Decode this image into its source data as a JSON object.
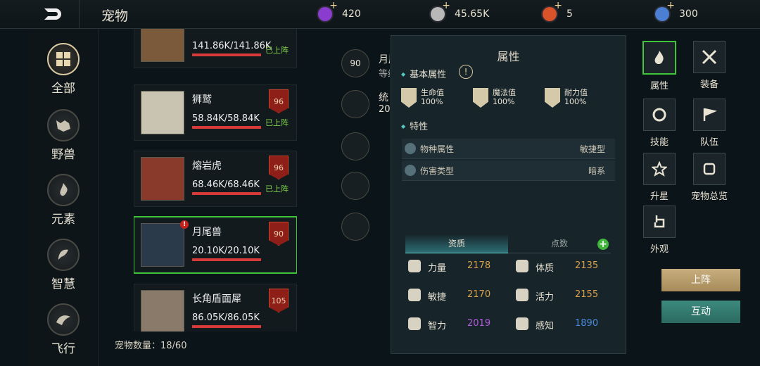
{
  "header": {
    "title": "宠物",
    "resources": [
      {
        "icon": "purple-gem-icon",
        "value": "420",
        "color": "#8a3ccf"
      },
      {
        "icon": "silver-coin-icon",
        "value": "45.65K",
        "color": "#b8b8b8"
      },
      {
        "icon": "fire-orb-icon",
        "value": "5",
        "color": "#d8522a"
      },
      {
        "icon": "blue-crystal-icon",
        "value": "300",
        "color": "#4a7fd4"
      }
    ]
  },
  "leftnav": {
    "items": [
      {
        "label": "全部",
        "icon": "grid-icon"
      },
      {
        "label": "野兽",
        "icon": "beast-icon"
      },
      {
        "label": "元素",
        "icon": "element-icon"
      },
      {
        "label": "智慧",
        "icon": "wisdom-icon"
      },
      {
        "label": "飞行",
        "icon": "flying-icon"
      }
    ]
  },
  "pets": [
    {
      "name": "",
      "hp": "141.86K/141.86K",
      "deployed": "已上阵",
      "level": "",
      "thumb": "#7a5a3a"
    },
    {
      "name": "狮鹫",
      "hp": "58.84K/58.84K",
      "deployed": "已上阵",
      "level": "96",
      "thumb": "#c9c4b2"
    },
    {
      "name": "熔岩虎",
      "hp": "68.46K/68.46K",
      "deployed": "已上阵",
      "level": "96",
      "thumb": "#8a3a2a"
    },
    {
      "name": "月尾兽",
      "hp": "20.10K/20.10K",
      "deployed": "",
      "level": "90",
      "thumb": "#2a3a4a"
    },
    {
      "name": "长角盾面犀",
      "hp": "86.05K/86.05K",
      "deployed": "",
      "level": "105",
      "thumb": "#8a7a6a"
    }
  ],
  "pet_count": "宠物数量：18/60",
  "middle": {
    "level_badge": "90",
    "name_partial": "月尾兽",
    "label2": "等级",
    "label3": "统",
    "value3": "20"
  },
  "attributes": {
    "title": "属性",
    "basic_title": "基本属性",
    "basic": [
      {
        "label": "生命值",
        "value": "100%"
      },
      {
        "label": "魔法值",
        "value": "100%"
      },
      {
        "label": "耐力值",
        "value": "100%"
      }
    ],
    "traits_title": "特性",
    "traits": [
      {
        "label": "物种属性",
        "value": "敏捷型"
      },
      {
        "label": "伤害类型",
        "value": "暗系"
      }
    ],
    "tabs": [
      "资质",
      "点数"
    ],
    "stats": [
      {
        "label": "力量",
        "value": "2178",
        "color": "#d8a04a"
      },
      {
        "label": "体质",
        "value": "2135",
        "color": "#d8a04a"
      },
      {
        "label": "敏捷",
        "value": "2170",
        "color": "#d8a04a"
      },
      {
        "label": "活力",
        "value": "2155",
        "color": "#d8a04a"
      },
      {
        "label": "智力",
        "value": "2019",
        "color": "#b05ad8"
      },
      {
        "label": "感知",
        "value": "1890",
        "color": "#4a8ad8"
      }
    ]
  },
  "right_menu": [
    {
      "label": "属性",
      "icon": "fire-icon"
    },
    {
      "label": "装备",
      "icon": "crossed-swords-icon"
    },
    {
      "label": "技能",
      "icon": "skill-icon"
    },
    {
      "label": "队伍",
      "icon": "flag-icon"
    },
    {
      "label": "升星",
      "icon": "star-icon"
    },
    {
      "label": "宠物总览",
      "icon": "overview-icon"
    },
    {
      "label": "外观",
      "icon": "hand-icon"
    }
  ],
  "actions": {
    "deploy": "上阵",
    "interact": "互动"
  }
}
